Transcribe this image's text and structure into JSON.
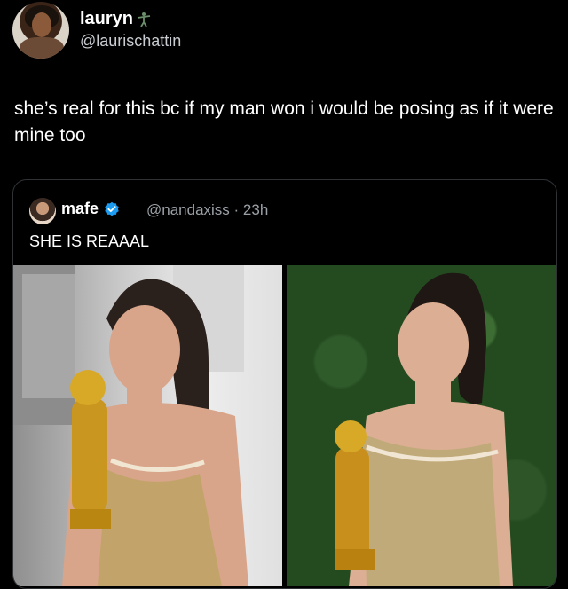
{
  "tweet": {
    "display_name": "lauryn",
    "handle": "@laurischattin",
    "text": "she’s real for this bc if my man won i would be posing as if it were mine too"
  },
  "quoted_tweet": {
    "display_name": "mafe",
    "handle_time": "@nandaxiss · 23h",
    "text": "SHE IS REAAAL"
  },
  "colors": {
    "background": "#000000",
    "verified_badge": "#1d9bf0",
    "border": "#2f3336"
  },
  "icons": {
    "verified": "verified-badge-icon",
    "name_emoji": "figure-emoji-icon"
  }
}
